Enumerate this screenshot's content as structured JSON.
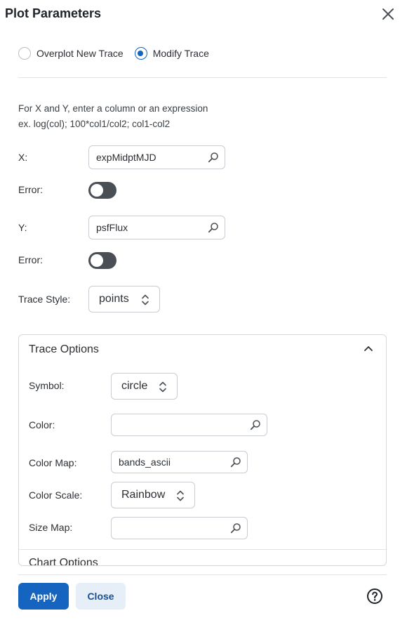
{
  "dialog": {
    "title": "Plot Parameters"
  },
  "mode": {
    "options": [
      "Overplot New Trace",
      "Modify Trace"
    ],
    "selected": "Modify Trace"
  },
  "instructions": {
    "line1": "For X and Y, enter a column or an expression",
    "line2": "ex. log(col); 100*col1/col2; col1-col2"
  },
  "x": {
    "label": "X:",
    "value": "expMidptMJD",
    "error_label": "Error:",
    "error_enabled": false
  },
  "y": {
    "label": "Y:",
    "value": "psfFlux",
    "error_label": "Error:",
    "error_enabled": false
  },
  "trace_style": {
    "label": "Trace Style:",
    "value": "points"
  },
  "trace_options": {
    "title": "Trace Options",
    "expanded": true,
    "symbol_label": "Symbol:",
    "symbol_value": "circle",
    "color_label": "Color:",
    "color_value": "",
    "color_map_label": "Color Map:",
    "color_map_value": "bands_ascii",
    "color_scale_label": "Color Scale:",
    "color_scale_value": "Rainbow",
    "size_map_label": "Size Map:",
    "size_map_value": "",
    "next_section_title": "Chart Options"
  },
  "footer": {
    "apply_label": "Apply",
    "close_label": "Close"
  },
  "colors": {
    "accent": "#1565c0",
    "toggle_off": "#4a4f55",
    "secondary_button_bg": "#e6eef7"
  },
  "icons": [
    "close-icon",
    "search-icon",
    "chevron-up-icon",
    "up-down-arrows-icon",
    "help-icon"
  ]
}
